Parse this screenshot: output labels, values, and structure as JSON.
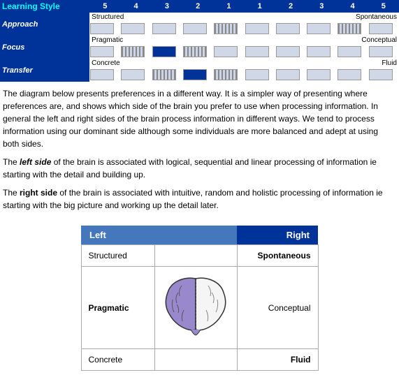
{
  "header": {
    "title": "Learning Style",
    "scale_left": [
      "5",
      "4",
      "3",
      "2",
      "1"
    ],
    "scale_right": [
      "1",
      "2",
      "3",
      "4",
      "5"
    ]
  },
  "rows": [
    {
      "label": "Approach",
      "left_label": "Structured",
      "right_label": "Spontaneous",
      "bars_left": [
        "empty",
        "empty",
        "empty",
        "empty",
        "striped"
      ],
      "bars_right": [
        "empty",
        "empty",
        "empty",
        "striped",
        "empty"
      ]
    },
    {
      "label": "Focus",
      "left_label": "Pragmatic",
      "right_label": "Conceptual",
      "bars_left": [
        "empty",
        "striped",
        "filled",
        "striped",
        "empty"
      ],
      "bars_right": [
        "empty",
        "empty",
        "empty",
        "empty",
        "empty"
      ]
    },
    {
      "label": "Transfer",
      "left_label": "Concrete",
      "right_label": "Fluid",
      "bars_left": [
        "empty",
        "empty",
        "striped",
        "filled",
        "striped"
      ],
      "bars_right": [
        "empty",
        "empty",
        "empty",
        "empty",
        "empty"
      ]
    }
  ],
  "description": {
    "para1": "The diagram below presents preferences in a different way. It is a simpler way of presenting where preferences are, and shows which side of the brain you prefer to use when processing information. In general the left and right sides of the brain process information in different ways. We tend to process information using our dominant side although some individuals are more balanced and adept at using both sides.",
    "para2_prefix": "The ",
    "para2_bold_italic": "left side",
    "para2_mid": " of the brain is associated with logical, sequential and linear processing of information ie starting with the detail and building up.",
    "para3_prefix": "The ",
    "para3_bold": "right side",
    "para3_mid": " of the brain is associated with intuitive, random and holistic processing of information ie starting with the big picture and working up the detail later."
  },
  "brain_diagram": {
    "left_header": "Left",
    "right_header": "Right",
    "rows": [
      {
        "left": "Structured",
        "right": "Spontaneous",
        "right_bold": true,
        "left_bold": false
      },
      {
        "left": "Pragmatic",
        "right": "Conceptual",
        "left_bold": true,
        "right_bold": false
      },
      {
        "left": "Concrete",
        "right": "Fluid",
        "right_bold": true,
        "left_bold": false
      }
    ]
  }
}
